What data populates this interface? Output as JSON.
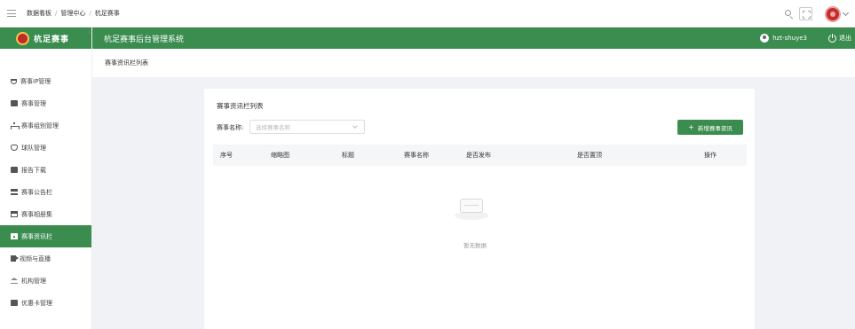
{
  "breadcrumb": [
    "数据看板",
    "管理中心",
    "杭足赛事"
  ],
  "logo": {
    "text": "杭足赛事"
  },
  "header": {
    "system_title": "杭足赛事后台管理系统",
    "username": "hzt-shuye3",
    "logout_label": "退出"
  },
  "sidebar": {
    "items": [
      {
        "label": "赛事IP管理",
        "icon": "trophy-icon",
        "active": false
      },
      {
        "label": "赛事管理",
        "icon": "grid-icon",
        "active": false
      },
      {
        "label": "赛事组别管理",
        "icon": "org-icon",
        "active": false
      },
      {
        "label": "球队管理",
        "icon": "shield-icon",
        "active": false
      },
      {
        "label": "报告下载",
        "icon": "report-icon",
        "active": false
      },
      {
        "label": "赛事公告栏",
        "icon": "board-icon",
        "active": false
      },
      {
        "label": "赛事相册集",
        "icon": "album-icon",
        "active": false
      },
      {
        "label": "赛事资讯栏",
        "icon": "news-icon",
        "active": true
      },
      {
        "label": "视频与直播",
        "icon": "video-icon",
        "active": false
      },
      {
        "label": "机构管理",
        "icon": "bank-icon",
        "active": false
      },
      {
        "label": "优惠卡管理",
        "icon": "card-icon",
        "active": false
      }
    ]
  },
  "page": {
    "header_title": "赛事资讯栏列表"
  },
  "card": {
    "title": "赛事资讯栏列表",
    "filter_label": "赛事名称:",
    "filter_placeholder": "选择赛事名称",
    "add_button": "新增赛事资讯",
    "columns": [
      "序号",
      "缩略图",
      "标题",
      "赛事名称",
      "是否发布",
      "是否置顶",
      "操作"
    ],
    "empty_text": "暂无数据"
  },
  "colors": {
    "brand_green": "#3a8c4f",
    "bg": "#f0f2f5"
  }
}
